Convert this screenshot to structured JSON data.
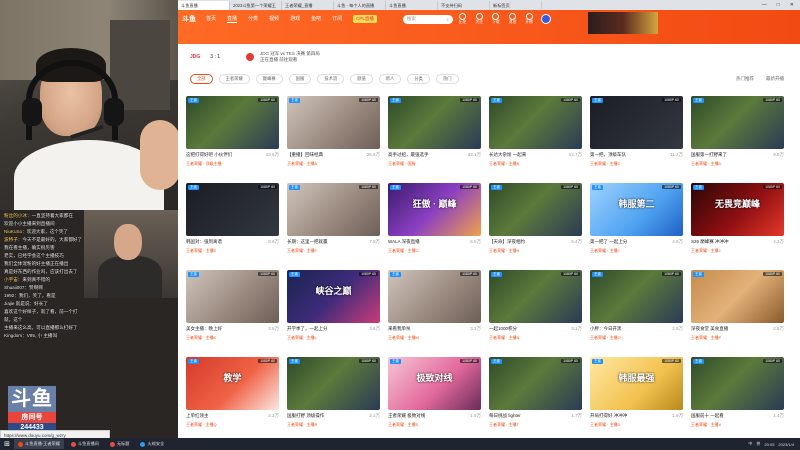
{
  "colors": {
    "accent": "#f24a13",
    "brand_blue": "#1e90ff",
    "taskbar": "#1f2430"
  },
  "stream_overlay": {
    "chat": [
      {
        "user": "粉丝的小冰",
        "text": "一直坚持着大家都在"
      },
      {
        "user": "",
        "text": "欢迎小小主播来到直播间"
      },
      {
        "user": "NiuKuSo",
        "text": "欢迎大家，这个笑了"
      },
      {
        "user": "波特子",
        "text": "今天不是最好的，大家都好了"
      },
      {
        "user": "",
        "text": "我在看主播，确实很厉害"
      },
      {
        "user": "",
        "text": "老实，已经学会这个主播技巧"
      },
      {
        "user": "",
        "text": "我们全体宠粉的好主播正在播出"
      },
      {
        "user": "",
        "text": "真是好东西的作业吗，应该打出去了"
      },
      {
        "user": "小宇宙",
        "text": "来到真不错的"
      },
      {
        "user": "",
        "text": "Shuaii007：赞啊啊"
      },
      {
        "user": "",
        "text": "1992：我们，笑了，看是"
      },
      {
        "user": "",
        "text": "Jiajie 就是说：好长了"
      },
      {
        "user": "",
        "text": "喜欢这个好样子，就了看，前一个打"
      },
      {
        "user": "",
        "text": "就，这个"
      },
      {
        "user": "",
        "text": "主播来这么高，可以直播那么打好了"
      },
      {
        "user": "",
        "text": "Kingdom：V95, 小 主播叫"
      }
    ],
    "logo_text": "斗鱼",
    "room_label": "房间号",
    "room_number": "244433",
    "status_url": "https://www.douyu.com/g_wzry"
  },
  "browser": {
    "tabs": [
      {
        "label": "斗鱼直播",
        "active": true
      },
      {
        "label": "2023斗鱼第一个荣耀王"
      },
      {
        "label": "王者荣耀_直播"
      },
      {
        "label": "斗鱼 - 每个人的直播"
      },
      {
        "label": "斗鱼直播"
      },
      {
        "label": "不支持扫码"
      },
      {
        "label": "新标签页"
      }
    ],
    "window_controls": [
      "—",
      "□",
      "✕"
    ]
  },
  "nav": {
    "brand": "斗鱼",
    "items": [
      {
        "label": "首页"
      },
      {
        "label": "直播",
        "active": true
      },
      {
        "label": "分类"
      },
      {
        "label": "视频"
      },
      {
        "label": "游戏"
      },
      {
        "label": "鱼吧"
      },
      {
        "label": "订阅"
      }
    ],
    "promo": "CPL直播",
    "search_placeholder": "搜索",
    "icons": [
      {
        "name": "history-icon",
        "label": "历史"
      },
      {
        "name": "follow-icon",
        "label": "关注"
      },
      {
        "name": "download-icon",
        "label": "下载"
      },
      {
        "name": "message-icon",
        "label": "消息"
      },
      {
        "name": "anchor-icon",
        "label": "开播"
      }
    ]
  },
  "match": {
    "team": "JDG",
    "score": "3 : 1",
    "info_line1": "JDG 冠军 vs TES 决赛 第四局",
    "info_line2": "正在直播 前往观看"
  },
  "filters": {
    "items": [
      {
        "label": "全部",
        "active": true
      },
      {
        "label": "王者荣耀"
      },
      {
        "label": "巅峰赛"
      },
      {
        "label": "国服"
      },
      {
        "label": "技术流"
      },
      {
        "label": "颜值"
      },
      {
        "label": "新人"
      },
      {
        "label": "分类"
      },
      {
        "label": "热门"
      }
    ],
    "view_options": [
      "热门推荐",
      "最新开播"
    ]
  },
  "cards": [
    {
      "title": "这把打得好吧 小伙伴们",
      "count": "22.6万",
      "meta": "王者荣耀 · 顶级主播",
      "badge": "1080P 60",
      "theme": "game"
    },
    {
      "title": "【重播】回味经典",
      "count": "26.5万",
      "meta": "王者荣耀 · 主播A",
      "badge": "1080P 60",
      "theme": "person"
    },
    {
      "title": "高手过招，最强选手",
      "count": "32.1万",
      "meta": "王者荣耀 · 国服",
      "badge": "1080P 60",
      "theme": "game"
    },
    {
      "title": "长达大杂烩 一起来",
      "count": "12.7万",
      "meta": "王者荣耀 · 主播B",
      "badge": "1080P 60",
      "theme": "game"
    },
    {
      "title": "第一把，顶级车队",
      "count": "11.2万",
      "meta": "王者荣耀 · 主播C",
      "badge": "1080P 60",
      "theme": "dark"
    },
    {
      "title": "国服第一打野来了",
      "count": "9.8万",
      "meta": "王者荣耀 · 主播D",
      "badge": "1080P 60",
      "theme": "game"
    },
    {
      "title": "韩国对：强到离谱",
      "count": "8.6万",
      "meta": "王者荣耀 · 主播E",
      "badge": "1080P 60",
      "theme": "dark"
    },
    {
      "title": "长期：这里一把就赢",
      "count": "7.9万",
      "meta": "王者荣耀 · 主播F",
      "badge": "1080P 60",
      "theme": "person"
    },
    {
      "title": "WALA 深夜直播",
      "count": "6.5万",
      "meta": "王者荣耀 · 主播G",
      "badge": "1080P 60",
      "theme": "purple",
      "big": "狂傲 · 巅峰"
    },
    {
      "title": "【天命】深夜相约",
      "count": "5.4万",
      "meta": "王者荣耀 · 主播H",
      "badge": "1080P 60",
      "theme": "game"
    },
    {
      "title": "第一把了 一起上分",
      "count": "4.8万",
      "meta": "王者荣耀 · 主播I",
      "badge": "1080P 60",
      "theme": "blue",
      "big": "韩服第二"
    },
    {
      "title": "S26 巅峰赛 冲冲冲",
      "count": "4.2万",
      "meta": "王者荣耀 · 主播J",
      "badge": "1080P 60",
      "theme": "red",
      "big": "无畏竞巅峰"
    },
    {
      "title": "美女主播：晚上好",
      "count": "3.9万",
      "meta": "王者荣耀 · 主播K",
      "badge": "1080P 60",
      "theme": "person"
    },
    {
      "title": "开学季了，一起上分",
      "count": "3.6万",
      "meta": "王者荣耀 · 主播L",
      "badge": "1080P 60",
      "theme": "banner",
      "big": "峡谷之巅"
    },
    {
      "title": "来看我单杀",
      "count": "3.3万",
      "meta": "王者荣耀 · 主播M",
      "badge": "1080P 60",
      "theme": "person"
    },
    {
      "title": "一起1000积分",
      "count": "3.1万",
      "meta": "王者荣耀 · 主播N",
      "badge": "1080P 60",
      "theme": "game"
    },
    {
      "title": "小胖：今日开黑",
      "count": "2.8万",
      "meta": "王者荣耀 · 主播O",
      "badge": "1080P 60",
      "theme": "game"
    },
    {
      "title": "深夜食堂 美食直播",
      "count": "2.5万",
      "meta": "王者荣耀 · 主播P",
      "badge": "1080P 60",
      "theme": "food"
    },
    {
      "title": "上单红领主",
      "count": "2.3万",
      "meta": "王者荣耀 · 主播Q",
      "badge": "1080P 60",
      "theme": "teach",
      "big": "教学"
    },
    {
      "title": "国服打野 顶级操作",
      "count": "2.1万",
      "meta": "王者荣耀 · 主播R",
      "badge": "1080P 60",
      "theme": "game"
    },
    {
      "title": "王者荣耀 极致对线",
      "count": "1.9万",
      "meta": "王者荣耀 · 主播S",
      "badge": "1080P 60",
      "theme": "pink",
      "big": "极致对线"
    },
    {
      "title": "每日挑战 fighter",
      "count": "1.7万",
      "meta": "王者荣耀 · 主播T",
      "badge": "1080P 60",
      "theme": "game"
    },
    {
      "title": "开局打得好 冲冲冲",
      "count": "1.6万",
      "meta": "王者荣耀 · 主播U",
      "badge": "1080P 60",
      "theme": "yellow",
      "big": "韩服最强"
    },
    {
      "title": "国服前十 一起看",
      "count": "1.4万",
      "meta": "王者荣耀 · 主播V",
      "badge": "1080P 60",
      "theme": "game"
    }
  ],
  "taskbar": {
    "start": "⊞",
    "tasks": [
      {
        "label": "斗鱼直播-王者荣耀",
        "color": "#f24a13",
        "active": true
      },
      {
        "label": "斗鱼直播间",
        "color": "#e94b3c"
      },
      {
        "label": "无标题",
        "color": "#e94b3c"
      },
      {
        "label": "火绒安全",
        "color": "#2b9af3"
      }
    ],
    "tray": [
      "中",
      "拼",
      "20:05",
      "2023/1/4"
    ]
  }
}
